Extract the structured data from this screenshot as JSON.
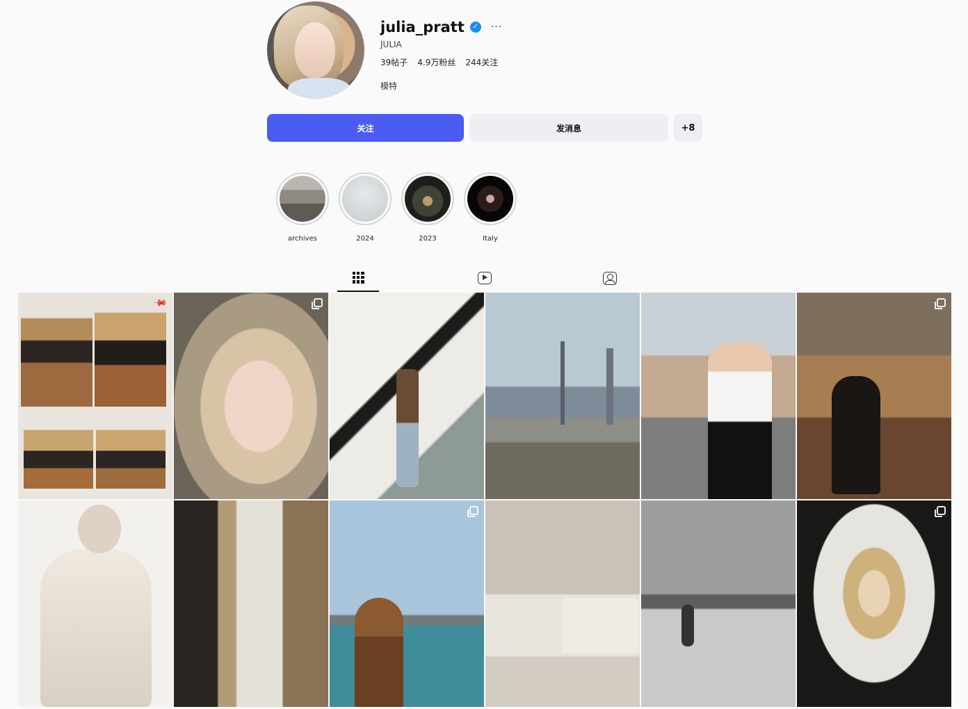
{
  "profile": {
    "username": "julia_pratt",
    "verified_icon": "verified-badge-icon",
    "more_icon": "···",
    "full_name": "JULIA",
    "stats": {
      "posts": "39帖子",
      "followers": "4.9万粉丝",
      "following": "244关注"
    },
    "bio": "模特"
  },
  "buttons": {
    "follow": "关注",
    "message": "发消息",
    "add_user": "+8"
  },
  "colors": {
    "follow_button": "#4a5cf2",
    "secondary_button": "#eeeff3",
    "verified": "#1d8cf2"
  },
  "highlights": [
    {
      "label": "archives"
    },
    {
      "label": "2024"
    },
    {
      "label": "2023"
    },
    {
      "label": "Italy"
    }
  ],
  "tabs": [
    {
      "icon": "grid-icon",
      "active": true
    },
    {
      "icon": "reels-icon",
      "active": false
    },
    {
      "icon": "tagged-icon",
      "active": false
    }
  ],
  "posts": [
    {
      "icon": "pin-icon"
    },
    {
      "icon": "carousel-icon"
    },
    {
      "icon": ""
    },
    {
      "icon": ""
    },
    {
      "icon": ""
    },
    {
      "icon": "carousel-icon"
    },
    {
      "icon": ""
    },
    {
      "icon": ""
    },
    {
      "icon": "carousel-icon"
    },
    {
      "icon": ""
    },
    {
      "icon": ""
    },
    {
      "icon": "carousel-icon"
    }
  ]
}
